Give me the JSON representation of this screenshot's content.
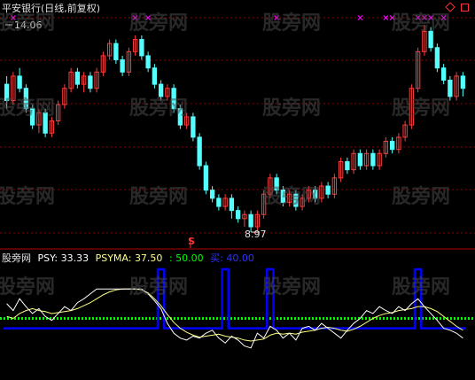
{
  "price_panel": {
    "title": "平安银行(日线,前复权)",
    "high_label": "14.06",
    "low_label": "8.97",
    "signal_label": "S"
  },
  "indicator_panel": {
    "name": "股旁网",
    "psy_label": "PSY: 33.33",
    "psyma_label": "PSYMA: 37.50",
    "level_50_label": ": 50.00",
    "buy_label": "买: 40.00"
  },
  "watermark_text": "股旁网",
  "colors": {
    "background": "#000000",
    "up_candle": "#ff3c3c",
    "down_candle": "#54ffff",
    "grid": "#8b0000",
    "magenta_marker": "#ff00ff",
    "psy_line": "#ffffff",
    "psyma_line": "#ffff80",
    "level_50": "#00ff00",
    "buy_line": "#0000ff",
    "title_text": "#e0e0e0"
  },
  "chart_data": {
    "type": "candlestick+indicator",
    "price_range": [
      8.97,
      14.06
    ],
    "psy_range": [
      0,
      100
    ],
    "psy_level": 50,
    "buy_level": 40,
    "candles": [
      [
        12.6,
        12.2,
        12.8,
        12.0
      ],
      [
        12.2,
        12.8,
        12.9,
        12.1
      ],
      [
        12.8,
        12.5,
        13.0,
        12.4
      ],
      [
        12.5,
        12.0,
        12.6,
        11.9
      ],
      [
        12.0,
        11.6,
        12.1,
        11.5
      ],
      [
        11.6,
        11.9,
        12.0,
        11.4
      ],
      [
        11.9,
        11.4,
        12.0,
        11.3
      ],
      [
        11.4,
        11.7,
        11.8,
        11.3
      ],
      [
        11.7,
        12.1,
        12.2,
        11.6
      ],
      [
        12.1,
        12.5,
        12.6,
        12.0
      ],
      [
        12.5,
        12.9,
        13.0,
        12.4
      ],
      [
        12.9,
        12.6,
        13.0,
        12.5
      ],
      [
        12.6,
        12.8,
        12.9,
        12.4
      ],
      [
        12.8,
        12.5,
        12.9,
        12.4
      ],
      [
        12.5,
        12.9,
        13.0,
        12.4
      ],
      [
        12.9,
        13.3,
        13.4,
        12.8
      ],
      [
        13.3,
        13.6,
        13.7,
        13.2
      ],
      [
        13.6,
        13.2,
        13.7,
        13.1
      ],
      [
        13.2,
        12.9,
        13.3,
        12.8
      ],
      [
        12.9,
        13.4,
        13.5,
        12.8
      ],
      [
        13.4,
        13.7,
        13.8,
        13.3
      ],
      [
        13.7,
        13.3,
        13.8,
        13.2
      ],
      [
        13.3,
        13.0,
        13.4,
        12.9
      ],
      [
        13.0,
        12.6,
        13.1,
        12.5
      ],
      [
        12.6,
        12.3,
        12.7,
        12.2
      ],
      [
        12.3,
        12.5,
        12.6,
        12.2
      ],
      [
        12.5,
        12.0,
        12.6,
        11.9
      ],
      [
        12.0,
        11.6,
        12.1,
        11.5
      ],
      [
        11.6,
        11.8,
        11.9,
        11.5
      ],
      [
        11.8,
        11.3,
        11.9,
        11.2
      ],
      [
        11.3,
        10.6,
        11.4,
        10.5
      ],
      [
        10.6,
        10.0,
        10.7,
        9.9
      ],
      [
        10.0,
        9.8,
        10.1,
        9.7
      ],
      [
        9.8,
        9.6,
        9.9,
        9.5
      ],
      [
        9.6,
        9.8,
        9.9,
        9.5
      ],
      [
        9.8,
        9.5,
        9.9,
        9.3
      ],
      [
        9.5,
        9.3,
        9.6,
        9.2
      ],
      [
        9.3,
        9.4,
        9.5,
        9.1
      ],
      [
        9.4,
        9.1,
        9.5,
        8.97
      ],
      [
        9.1,
        9.4,
        9.5,
        9.0
      ],
      [
        9.4,
        9.9,
        10.0,
        9.3
      ],
      [
        9.9,
        10.3,
        10.4,
        9.8
      ],
      [
        10.3,
        10.0,
        10.4,
        9.9
      ],
      [
        10.0,
        9.7,
        10.1,
        9.6
      ],
      [
        9.7,
        9.9,
        10.0,
        9.6
      ],
      [
        9.9,
        9.6,
        10.0,
        9.5
      ],
      [
        9.6,
        9.8,
        9.9,
        9.5
      ],
      [
        9.8,
        10.0,
        10.1,
        9.7
      ],
      [
        10.0,
        9.8,
        10.1,
        9.7
      ],
      [
        9.8,
        10.1,
        10.2,
        9.7
      ],
      [
        10.1,
        9.9,
        10.2,
        9.8
      ],
      [
        9.9,
        10.3,
        10.4,
        9.8
      ],
      [
        10.3,
        10.7,
        10.8,
        10.2
      ],
      [
        10.7,
        10.5,
        10.8,
        10.4
      ],
      [
        10.5,
        10.9,
        11.0,
        10.4
      ],
      [
        10.9,
        10.6,
        11.0,
        10.5
      ],
      [
        10.6,
        10.9,
        11.0,
        10.5
      ],
      [
        10.9,
        10.6,
        11.0,
        10.5
      ],
      [
        10.6,
        10.9,
        11.0,
        10.5
      ],
      [
        10.9,
        11.2,
        11.3,
        10.8
      ],
      [
        11.2,
        11.0,
        11.3,
        10.9
      ],
      [
        11.0,
        11.3,
        11.4,
        10.9
      ],
      [
        11.3,
        11.6,
        11.7,
        11.2
      ],
      [
        11.6,
        12.5,
        12.6,
        11.5
      ],
      [
        12.5,
        13.4,
        13.5,
        12.4
      ],
      [
        13.4,
        13.9,
        14.06,
        13.3
      ],
      [
        13.9,
        13.5,
        14.0,
        13.4
      ],
      [
        13.5,
        13.0,
        13.6,
        12.9
      ],
      [
        13.0,
        12.7,
        13.1,
        12.6
      ],
      [
        12.7,
        12.3,
        12.8,
        12.2
      ],
      [
        12.3,
        12.8,
        12.9,
        12.2
      ],
      [
        12.8,
        12.5,
        12.9,
        12.3
      ]
    ],
    "psy": [
      65,
      58,
      70,
      62,
      55,
      60,
      52,
      48,
      55,
      62,
      58,
      66,
      70,
      75,
      80,
      80,
      80,
      80,
      80,
      80,
      80,
      80,
      75,
      68,
      60,
      45,
      35,
      30,
      28,
      32,
      30,
      35,
      38,
      30,
      25,
      32,
      28,
      22,
      20,
      35,
      30,
      42,
      38,
      30,
      35,
      28,
      40,
      42,
      38,
      45,
      40,
      35,
      30,
      38,
      45,
      50,
      58,
      55,
      62,
      58,
      55,
      62,
      58,
      65,
      70,
      62,
      55,
      48,
      40,
      38,
      35,
      30
    ],
    "psyma": [
      52,
      50,
      55,
      58,
      60,
      58,
      57,
      55,
      56,
      57,
      58,
      60,
      63,
      66,
      70,
      74,
      77,
      79,
      80,
      80,
      80,
      79,
      76,
      70,
      63,
      54,
      46,
      40,
      36,
      33,
      31,
      32,
      33,
      34,
      32,
      31,
      30,
      28,
      27,
      28,
      29,
      33,
      35,
      34,
      35,
      34,
      36,
      37,
      38,
      40,
      41,
      40,
      38,
      37,
      39,
      42,
      46,
      50,
      53,
      55,
      56,
      58,
      59,
      60,
      62,
      62,
      60,
      57,
      52,
      47,
      42,
      38
    ],
    "buy_signal": [
      0,
      0,
      0,
      0,
      0,
      0,
      0,
      0,
      0,
      0,
      0,
      0,
      0,
      0,
      0,
      0,
      0,
      0,
      0,
      0,
      0,
      0,
      0,
      0,
      1,
      0,
      0,
      0,
      0,
      0,
      0,
      0,
      0,
      0,
      1,
      0,
      0,
      0,
      0,
      0,
      0,
      1,
      0,
      0,
      0,
      0,
      0,
      0,
      0,
      0,
      0,
      0,
      0,
      0,
      0,
      0,
      0,
      0,
      0,
      0,
      0,
      0,
      0,
      0,
      1,
      0,
      0,
      0,
      0,
      0,
      0,
      0
    ],
    "top_markers": [
      1,
      20,
      22,
      42,
      55,
      59,
      60,
      64,
      65,
      66,
      68
    ]
  }
}
